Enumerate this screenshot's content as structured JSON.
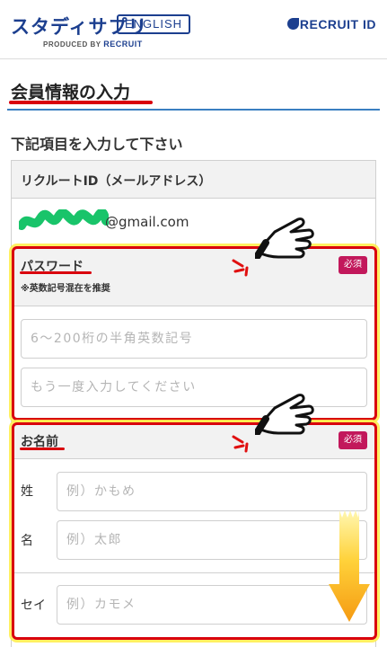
{
  "header": {
    "brand_name": "スタディサプリ",
    "brand_badge": "ENGLISH",
    "produced_by_prefix": "PRODUCED BY",
    "produced_by_company": "RECRUIT",
    "recruit_id_logo": "RECRUIT ID"
  },
  "page": {
    "title": "会員情報の入力",
    "lead": "下記項目を入力して下さい"
  },
  "form": {
    "recruit_id_label": "リクルートID（メールアドレス）",
    "email_suffix": "@gmail.com",
    "password": {
      "label": "パスワード",
      "note": "※英数記号混在を推奨",
      "required_badge": "必須",
      "placeholder": "6～200桁の半角英数記号",
      "confirm_placeholder": "もう一度入力してください"
    },
    "name": {
      "label": "お名前",
      "required_badge": "必須",
      "sei_label": "姓",
      "sei_placeholder": "例）かもめ",
      "mei_label": "名",
      "mei_placeholder": "例）太郎",
      "sei_kana_label": "セイ",
      "sei_kana_placeholder": "例）カモメ"
    }
  },
  "colors": {
    "brand_blue": "#1c3f8f",
    "annotation_red": "#d9000d",
    "required_pink": "#c2185b",
    "title_rule_blue": "#3a7fc1",
    "scribble_green": "#19c46a",
    "arrow_orange": "#f7a21b"
  },
  "icons": {
    "pointing_hand": "pointing-hand-icon",
    "down_arrow": "down-arrow-icon"
  }
}
